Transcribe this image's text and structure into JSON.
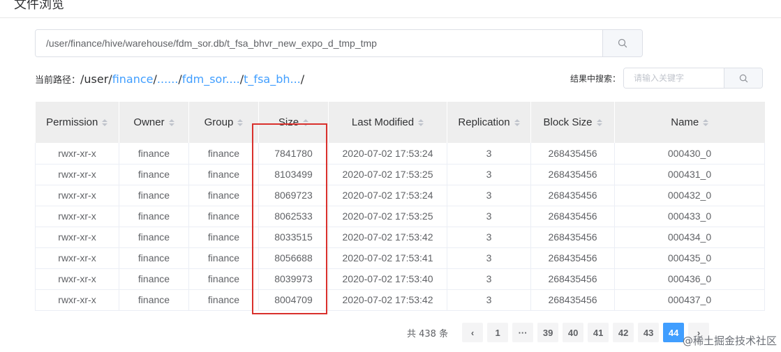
{
  "page": {
    "title": "文件浏览"
  },
  "path_search": {
    "value": "/user/finance/hive/warehouse/fdm_sor.db/t_fsa_bhvr_new_expo_d_tmp_tmp"
  },
  "breadcrumb": {
    "prefix": "当前路径：",
    "root": "/user/",
    "links": [
      "finance",
      "......",
      "fdm_sor....",
      "t_fsa_bh..."
    ],
    "separator": "/"
  },
  "result_search": {
    "label": "结果中搜索：",
    "placeholder": "请输入关键字"
  },
  "table": {
    "columns": [
      "Permission",
      "Owner",
      "Group",
      "Size",
      "Last Modified",
      "Replication",
      "Block Size",
      "Name"
    ],
    "rows": [
      [
        "rwxr-xr-x",
        "finance",
        "finance",
        "7841780",
        "2020-07-02 17:53:24",
        "3",
        "268435456",
        "000430_0"
      ],
      [
        "rwxr-xr-x",
        "finance",
        "finance",
        "8103499",
        "2020-07-02 17:53:25",
        "3",
        "268435456",
        "000431_0"
      ],
      [
        "rwxr-xr-x",
        "finance",
        "finance",
        "8069723",
        "2020-07-02 17:53:24",
        "3",
        "268435456",
        "000432_0"
      ],
      [
        "rwxr-xr-x",
        "finance",
        "finance",
        "8062533",
        "2020-07-02 17:53:25",
        "3",
        "268435456",
        "000433_0"
      ],
      [
        "rwxr-xr-x",
        "finance",
        "finance",
        "8033515",
        "2020-07-02 17:53:42",
        "3",
        "268435456",
        "000434_0"
      ],
      [
        "rwxr-xr-x",
        "finance",
        "finance",
        "8056688",
        "2020-07-02 17:53:41",
        "3",
        "268435456",
        "000435_0"
      ],
      [
        "rwxr-xr-x",
        "finance",
        "finance",
        "8039973",
        "2020-07-02 17:53:40",
        "3",
        "268435456",
        "000436_0"
      ],
      [
        "rwxr-xr-x",
        "finance",
        "finance",
        "8004709",
        "2020-07-02 17:53:42",
        "3",
        "268435456",
        "000437_0"
      ]
    ]
  },
  "pagination": {
    "total": "共 438 条",
    "pages": [
      "‹",
      "1",
      "···",
      "39",
      "40",
      "41",
      "42",
      "43",
      "44",
      "›"
    ],
    "active": "44"
  },
  "watermark": "@稀土掘金技术社区",
  "colors": {
    "accent": "#409eff",
    "highlight": "#d9302c",
    "header_bg": "#eeeeee"
  }
}
